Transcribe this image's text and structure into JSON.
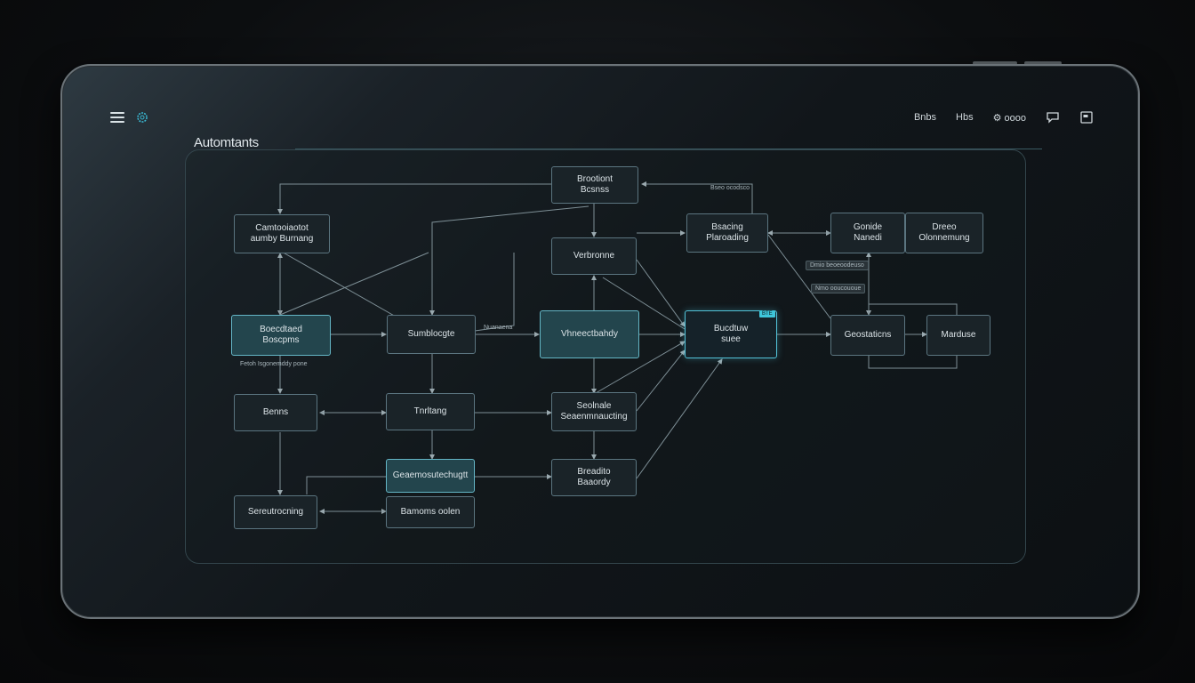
{
  "header": {
    "app_title": "Automtants",
    "right_items": [
      "Bnbs",
      "Hbs",
      "oooo"
    ],
    "logo_icon": "gear-logo-icon",
    "menu_icon": "hamburger-menu-icon",
    "chat_icon": "chat-bubble-icon",
    "window_icon": "window-icon"
  },
  "nodes": {
    "top_center": "Brootiont\nBcsnss",
    "left_top": "Camtooiaotot\naumby Burnang",
    "center_mid": "Verbronne",
    "right_top_left": "Bsacing\nPlaroading",
    "right_box_a": "Gonide\nNanedi",
    "right_box_b": "Dreeo\nOlonnemung",
    "left_mid": "Boecdtaed\nBoscpms",
    "mid_left": "Sumblocgte",
    "main_hub": "Vhneectbahdy",
    "focus_node": "Bucdtuw\nsuee",
    "right_mid": "Geostaticns",
    "right_far": "Marduse",
    "left_low": "Benns",
    "mid_low": "Tnrltang",
    "center_low": "Seolnale\nSeaenmnaucting",
    "left_bottom": "Sereutrocning",
    "mid_bottom_top": "Geaemosutechugtt",
    "mid_bottom": "Bamoms oolen",
    "center_bottom": "Breadito\nBaaordy"
  },
  "tags": {
    "top_arrow": "Bseo ocodsco",
    "mid_arrow": "Nuanaena",
    "right_tag_1": "Dmio beoeoodeuso",
    "right_tag_2": "Nmo ooucououe",
    "left_caption": "Fetoh Isgonemddy pone",
    "focus_badge": "BTE"
  },
  "colors": {
    "accent": "#3ec6da",
    "node_border": "#5b7580",
    "node_fill": "#1a2328",
    "line": "#7e8f96"
  }
}
